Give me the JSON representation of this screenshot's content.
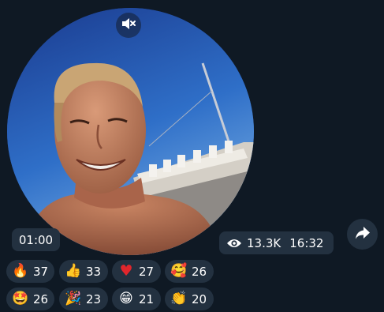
{
  "video": {
    "duration": "01:00",
    "muted": true,
    "mute_icon": "speaker-muted-icon"
  },
  "meta": {
    "views": "13.3K",
    "time": "16:32",
    "views_icon": "eye-icon"
  },
  "share": {
    "icon": "share-arrow-icon"
  },
  "reactions": [
    {
      "emoji": "🔥",
      "name": "fire",
      "count": "37"
    },
    {
      "emoji": "👍",
      "name": "thumbs-up",
      "count": "33"
    },
    {
      "emoji": "♥",
      "name": "heart",
      "count": "27"
    },
    {
      "emoji": "🥰",
      "name": "smiling-hearts",
      "count": "26"
    },
    {
      "emoji": "🤩",
      "name": "star-struck",
      "count": "26"
    },
    {
      "emoji": "🎉",
      "name": "party-popper",
      "count": "23"
    },
    {
      "emoji": "😁",
      "name": "grinning",
      "count": "21"
    },
    {
      "emoji": "👏",
      "name": "clapping",
      "count": "20"
    }
  ],
  "colors": {
    "background": "#0f1924",
    "pill": "#233140",
    "text": "#ffffff",
    "heart": "#e0262c"
  }
}
